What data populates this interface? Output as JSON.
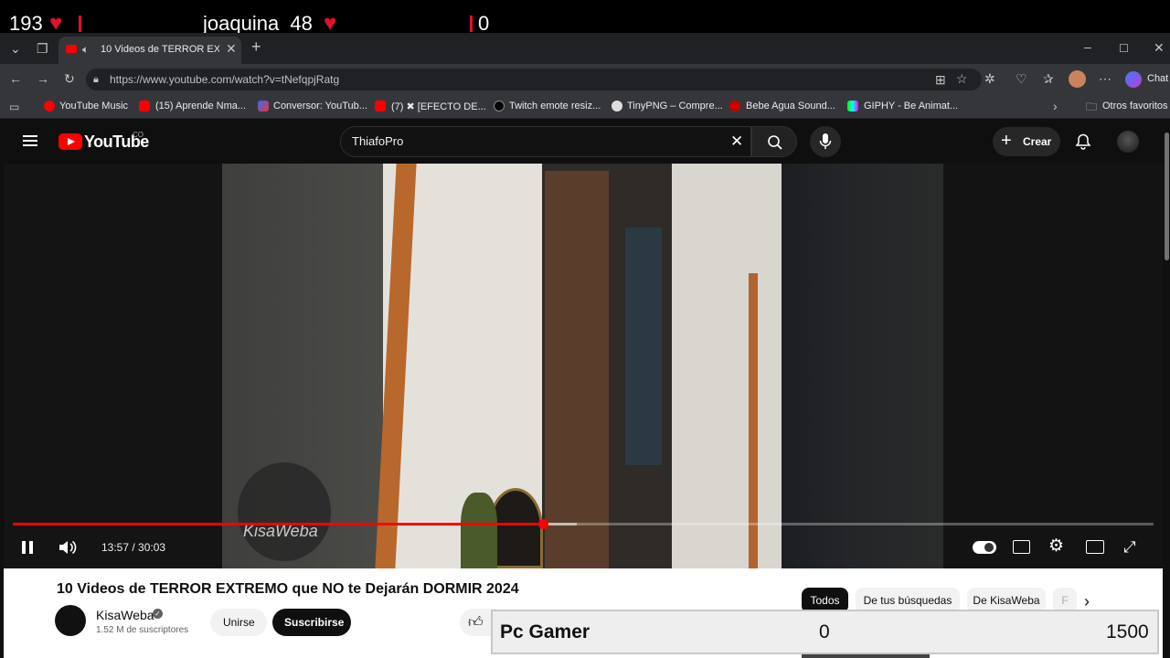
{
  "stream_overlay": {
    "likes_count": "193",
    "username": "joaquina_48",
    "counter": "0"
  },
  "browser": {
    "tab_title": "10 Videos de TERROR EXTREMO",
    "url": "https://www.youtube.com/watch?v=tNefqpjRatg",
    "chat_label": "Chat",
    "bookmarks": [
      "YouTube Music",
      "(15) Aprende Nma...",
      "Conversor: YouTub...",
      "(7) ✖ [EFECTO DE...",
      "Twitch emote resiz...",
      "TinyPNG – Compre...",
      "Bebe Agua Sound...",
      "GIPHY - Be Animat..."
    ],
    "other_bookmarks": "Otros favoritos"
  },
  "youtube": {
    "logo_text": "YouTube",
    "country_code": "CO",
    "search_value": "ThiafoPro",
    "create_label": "Crear"
  },
  "player": {
    "time_display": "13:57 / 30:03",
    "progress": 0.465,
    "buffered": 0.494,
    "watermark": "KisaWeba"
  },
  "video_info": {
    "title": "10 Videos de TERROR EXTREMO que NO te Dejarán DORMIR 2024",
    "channel_name": "KisaWeba",
    "subscribers": "1.52 M de suscriptores",
    "join_label": "Unirse",
    "subscribe_label": "Suscribirse"
  },
  "chips": [
    "Todos",
    "De tus búsquedas",
    "De KisaWeba",
    "F"
  ],
  "pc_gamer": {
    "label": "Pc Gamer",
    "current": "0",
    "goal": "1500"
  },
  "colors": {
    "youtube_red": "#ff0000",
    "heart_red": "#e0102f",
    "dark_bg": "#0f0f0f"
  }
}
